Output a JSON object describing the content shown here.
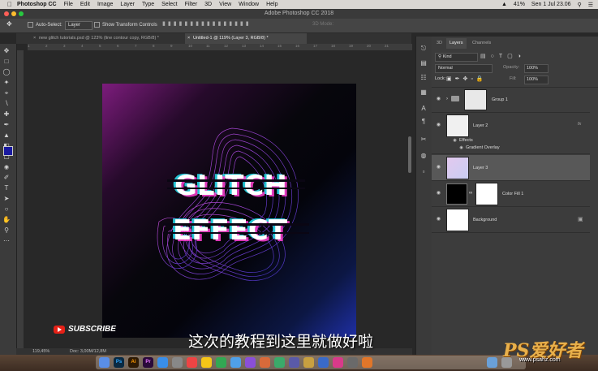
{
  "menubar": {
    "app_name": "Photoshop CC",
    "items": [
      "File",
      "Edit",
      "Image",
      "Layer",
      "Type",
      "Select",
      "Filter",
      "3D",
      "View",
      "Window",
      "Help"
    ],
    "battery": "41%",
    "datetime": "Sen 1 Jul  23.06"
  },
  "titlebar": {
    "title": "Adobe Photoshop CC 2018"
  },
  "options": {
    "auto_select_label": "Auto-Select:",
    "auto_select_value": "Layer",
    "transform_label": "Show Transform Controls",
    "mode_label": "3D Mode:"
  },
  "tabs": [
    {
      "label": "new glitch tutorials.psd @ 123% (line contour copy, RGB/8) *"
    },
    {
      "label": "Untitled-1 @ 119% (Layer 3, RGB/8) *"
    }
  ],
  "ruler_ticks": [
    "1",
    "2",
    "3",
    "4",
    "5",
    "6",
    "7",
    "8",
    "9",
    "10",
    "11",
    "12",
    "13",
    "14",
    "15",
    "16",
    "17",
    "18",
    "19",
    "20",
    "21"
  ],
  "artwork": {
    "line1": "GLITCH",
    "line2": "EFFECT"
  },
  "statusbar": {
    "zoom": "119,45%",
    "doc": "Doc: 3,00M/12,8M"
  },
  "panels": {
    "tabs": [
      "3D",
      "Layers",
      "Channels"
    ],
    "filter_label": "Kind",
    "blend_mode": "Normal",
    "opacity_label": "Opacity:",
    "opacity_value": "100%",
    "lock_label": "Lock:",
    "fill_label": "Fill:",
    "fill_value": "100%",
    "layers": [
      {
        "name": "Group 1"
      },
      {
        "name": "Layer 2",
        "fx": "fx",
        "effects_label": "Effects",
        "effect": "Gradient Overlay"
      },
      {
        "name": "Layer 3"
      },
      {
        "name": "Color Fill 1"
      },
      {
        "name": "Background"
      }
    ]
  },
  "overlay": {
    "subscribe": "SUBSCRIBE",
    "caption": "这次的教程到这里就做好啦",
    "watermark": "PS爱好者",
    "watermark_url": "www.psahz.com"
  },
  "dock_apps": [
    "Ps",
    "Ai",
    "Pr"
  ],
  "colors": {
    "foreground": "#1a1aa0",
    "background": "#000000",
    "accent_magenta": "#b23bd6",
    "accent_cyan": "#27e3f2"
  }
}
